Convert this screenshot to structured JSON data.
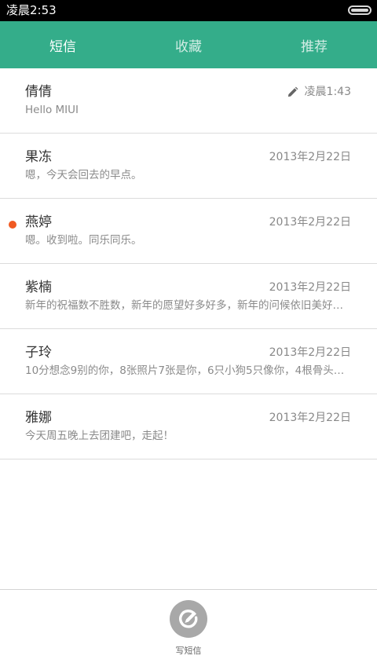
{
  "status_bar": {
    "time": "凌晨2:53"
  },
  "tabs": [
    {
      "label": "短信",
      "active": true
    },
    {
      "label": "收藏",
      "active": false
    },
    {
      "label": "推荐",
      "active": false
    }
  ],
  "conversations": [
    {
      "name": "倩倩",
      "preview": "Hello MIUI",
      "date": "凌晨1:43",
      "draft": true,
      "unread": false
    },
    {
      "name": "果冻",
      "preview": "嗯，今天会回去的早点。",
      "date": "2013年2月22日",
      "draft": false,
      "unread": false
    },
    {
      "name": "燕婷",
      "preview": "嗯。收到啦。同乐同乐。",
      "date": "2013年2月22日",
      "draft": false,
      "unread": true
    },
    {
      "name": "紫楠",
      "preview": "新年的祝福数不胜数，新年的愿望好多好多，新年的问候依旧美好…",
      "date": "2013年2月22日",
      "draft": false,
      "unread": false
    },
    {
      "name": "子玲",
      "preview": "10分想念9别的你，8张照片7张是你，6只小狗5只像你，4根骨头…",
      "date": "2013年2月22日",
      "draft": false,
      "unread": false
    },
    {
      "name": "雅娜",
      "preview": "今天周五晚上去团建吧，走起！",
      "date": "2013年2月22日",
      "draft": false,
      "unread": false
    }
  ],
  "compose": {
    "label": "写短信",
    "icon": "compose-icon"
  },
  "colors": {
    "accent": "#34ad8a",
    "unread_dot": "#f05a22"
  }
}
